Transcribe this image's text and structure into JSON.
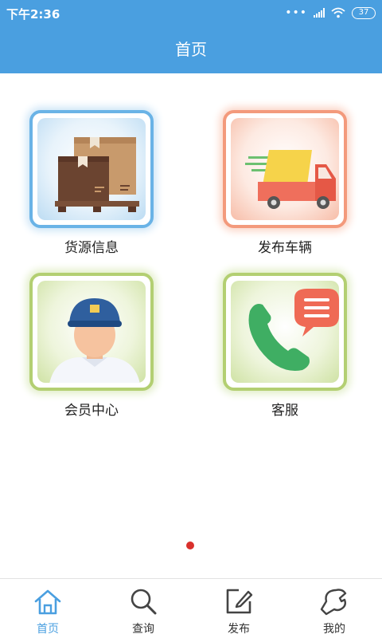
{
  "status_bar": {
    "time": "下午2:36",
    "dots": "•••",
    "battery": "37"
  },
  "header": {
    "title": "首页"
  },
  "tiles": [
    {
      "label": "货源信息",
      "icon": "cargo-boxes-icon",
      "color": "#6ab3e6"
    },
    {
      "label": "发布车辆",
      "icon": "delivery-truck-icon",
      "color": "#f39a7c"
    },
    {
      "label": "会员中心",
      "icon": "member-avatar-icon",
      "color": "#b3cf72"
    },
    {
      "label": "客服",
      "icon": "phone-chat-icon",
      "color": "#b3cf72"
    }
  ],
  "pager": {
    "active_color": "#d9302c"
  },
  "bottom_nav": {
    "items": [
      {
        "label": "首页",
        "icon": "home-icon",
        "active": true
      },
      {
        "label": "查询",
        "icon": "search-icon",
        "active": false
      },
      {
        "label": "发布",
        "icon": "edit-icon",
        "active": false
      },
      {
        "label": "我的",
        "icon": "wrench-icon",
        "active": false
      }
    ]
  },
  "colors": {
    "primary": "#4a9fe0",
    "text": "#222222"
  }
}
